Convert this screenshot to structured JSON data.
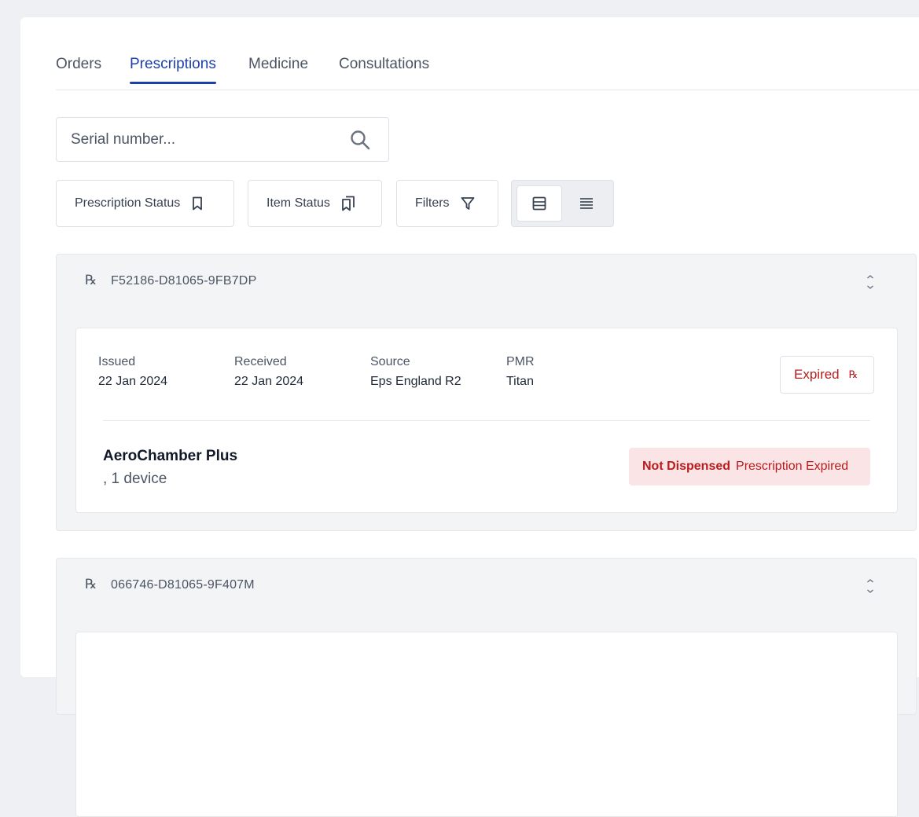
{
  "tabs": [
    {
      "label": "Orders"
    },
    {
      "label": "Prescriptions"
    },
    {
      "label": "Medicine"
    },
    {
      "label": "Consultations"
    }
  ],
  "search": {
    "placeholder": "Serial number..."
  },
  "filters": {
    "prescription_status": "Prescription Status",
    "item_status": "Item Status",
    "filters": "Filters"
  },
  "colors": {
    "accent": "#1e40af",
    "danger": "#b91c1c",
    "danger_bg": "#fbe4e6"
  },
  "prescriptions": [
    {
      "rx_symbol": "℞",
      "serial": "F52186-D81065-9FB7DP",
      "meta": {
        "issued_label": "Issued",
        "issued": "22 Jan 2024",
        "received_label": "Received",
        "received": "22 Jan 2024",
        "source_label": "Source",
        "source": "Eps England R2",
        "pmr_label": "PMR",
        "pmr": "Titan"
      },
      "status": "Expired",
      "items": [
        {
          "name": "AeroChamber Plus",
          "quantity": ", 1 device",
          "status": "Not Dispensed",
          "reason": "Prescription Expired"
        }
      ]
    },
    {
      "rx_symbol": "℞",
      "serial": "066746-D81065-9F407M"
    }
  ]
}
